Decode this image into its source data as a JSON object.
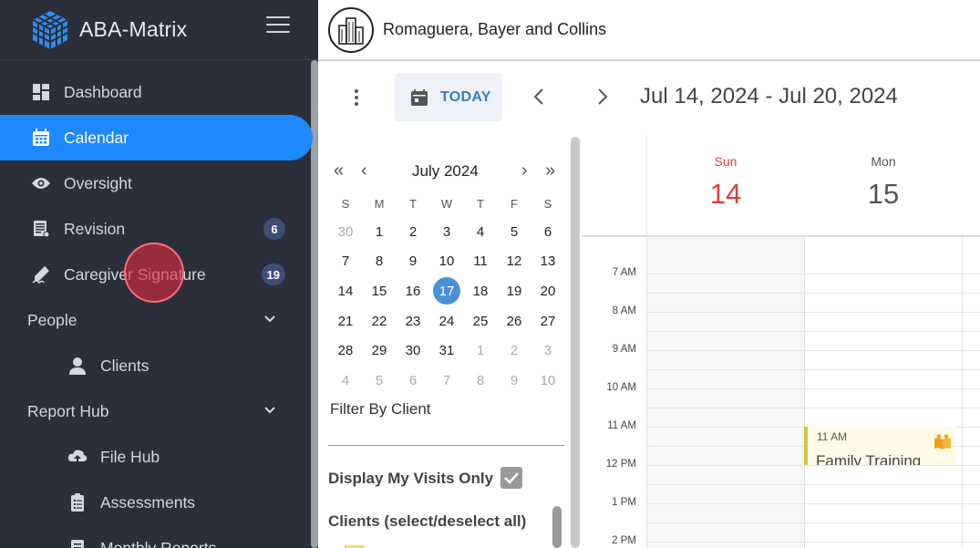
{
  "app": {
    "title": "ABA-Matrix"
  },
  "sidebar": {
    "items": [
      {
        "label": "Dashboard",
        "icon": "dashboard-icon"
      },
      {
        "label": "Calendar",
        "icon": "calendar-icon",
        "active": true
      },
      {
        "label": "Oversight",
        "icon": "eye-icon"
      },
      {
        "label": "Revision",
        "icon": "document-icon",
        "badge": "6"
      },
      {
        "label": "Caregiver Signature",
        "icon": "signature-icon",
        "badge": "19"
      }
    ],
    "sections": {
      "people": {
        "label": "People",
        "items": [
          {
            "label": "Clients",
            "icon": "person-icon"
          }
        ]
      },
      "report_hub": {
        "label": "Report Hub",
        "items": [
          {
            "label": "File Hub",
            "icon": "cloud-upload-icon"
          },
          {
            "label": "Assessments",
            "icon": "clipboard-icon"
          },
          {
            "label": "Monthly Reports",
            "icon": "report-icon"
          }
        ]
      }
    }
  },
  "header": {
    "company": "Romaguera, Bayer and Collins"
  },
  "toolbar": {
    "today_label": "TODAY",
    "date_range": "Jul 14, 2024 - Jul 20, 2024"
  },
  "mini_calendar": {
    "month_label": "July 2024",
    "weekdays": [
      "S",
      "M",
      "T",
      "W",
      "T",
      "F",
      "S"
    ],
    "weeks": [
      [
        "30",
        "1",
        "2",
        "3",
        "4",
        "5",
        "6"
      ],
      [
        "7",
        "8",
        "9",
        "10",
        "11",
        "12",
        "13"
      ],
      [
        "14",
        "15",
        "16",
        "17",
        "18",
        "19",
        "20"
      ],
      [
        "21",
        "22",
        "23",
        "24",
        "25",
        "26",
        "27"
      ],
      [
        "28",
        "29",
        "30",
        "31",
        "1",
        "2",
        "3"
      ],
      [
        "4",
        "5",
        "6",
        "7",
        "8",
        "9",
        "10"
      ]
    ],
    "selected_day": "17"
  },
  "filters": {
    "filter_by_client": "Filter By Client",
    "display_my_visits_only": "Display My Visits Only",
    "display_my_visits_checked": true,
    "clients_select_all": "Clients (select/deselect all)"
  },
  "calendar": {
    "days": [
      {
        "name": "Sun",
        "num": "14",
        "color": "#e03c3c"
      },
      {
        "name": "Mon",
        "num": "15",
        "color": "#555555"
      }
    ],
    "time_labels": [
      "7 AM",
      "8 AM",
      "9 AM",
      "10 AM",
      "11 AM",
      "12 PM",
      "1 PM",
      "2 PM"
    ],
    "events": [
      {
        "time": "11 AM",
        "title": "Family Training",
        "icon": "book-icon",
        "color": "#d8c43a"
      }
    ]
  },
  "colors": {
    "sidebar_bg": "#2b2f3a",
    "accent": "#1e88ff",
    "badge": "#3f4d7a",
    "selected_day": "#4a90d9",
    "today_text": "#2f80c8"
  }
}
